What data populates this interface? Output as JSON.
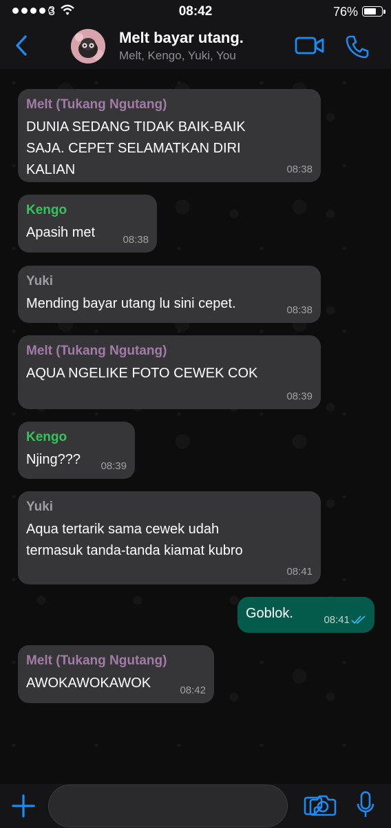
{
  "status_bar": {
    "carrier": "3",
    "time": "08:42",
    "battery": "76%",
    "battery_level": 0.76
  },
  "header": {
    "title": "Melt bayar utang.",
    "members": "Melt, Kengo, Yuki, You"
  },
  "colors": {
    "accent": "#1b8cf2",
    "melt": "#a17ca6",
    "kengo": "#36c35b",
    "yuki": "#9d9da2",
    "incoming_bubble": "#363638",
    "outgoing_bubble": "#045b4b"
  },
  "messages": [
    {
      "sender": "Melt (Tukang Ngutang)",
      "text": "DUNIA SEDANG TIDAK BAIK-BAIK\nSAJA. CEPET SELAMATKAN DIRI\nKALIAN",
      "time": "08:38"
    },
    {
      "sender": "Kengo",
      "text": "Apasih met",
      "time": "08:38"
    },
    {
      "sender": "Yuki",
      "text": "Mending bayar utang lu sini cepet.",
      "time": "08:38"
    },
    {
      "sender": "Melt (Tukang Ngutang)",
      "text": "AQUA NGELIKE FOTO CEWEK COK",
      "time": "08:39"
    },
    {
      "sender": "Kengo",
      "text": "Njing???",
      "time": "08:39"
    },
    {
      "sender": "Yuki",
      "text": "Aqua tertarik sama cewek udah\ntermasuk tanda-tanda kiamat kubro",
      "time": "08:41"
    },
    {
      "text": "Goblok.",
      "time": "08:41",
      "status": "read"
    },
    {
      "sender": "Melt (Tukang Ngutang)",
      "text": "AWOKAWOKAWOK",
      "time": "08:42"
    }
  ],
  "icons": {
    "back": "chevron-left-icon",
    "video": "video-call-icon",
    "phone": "phone-icon",
    "plus": "plus-icon",
    "sticker": "sticker-icon",
    "camera": "camera-icon",
    "mic": "microphone-icon",
    "read_receipt": "double-check-icon"
  }
}
